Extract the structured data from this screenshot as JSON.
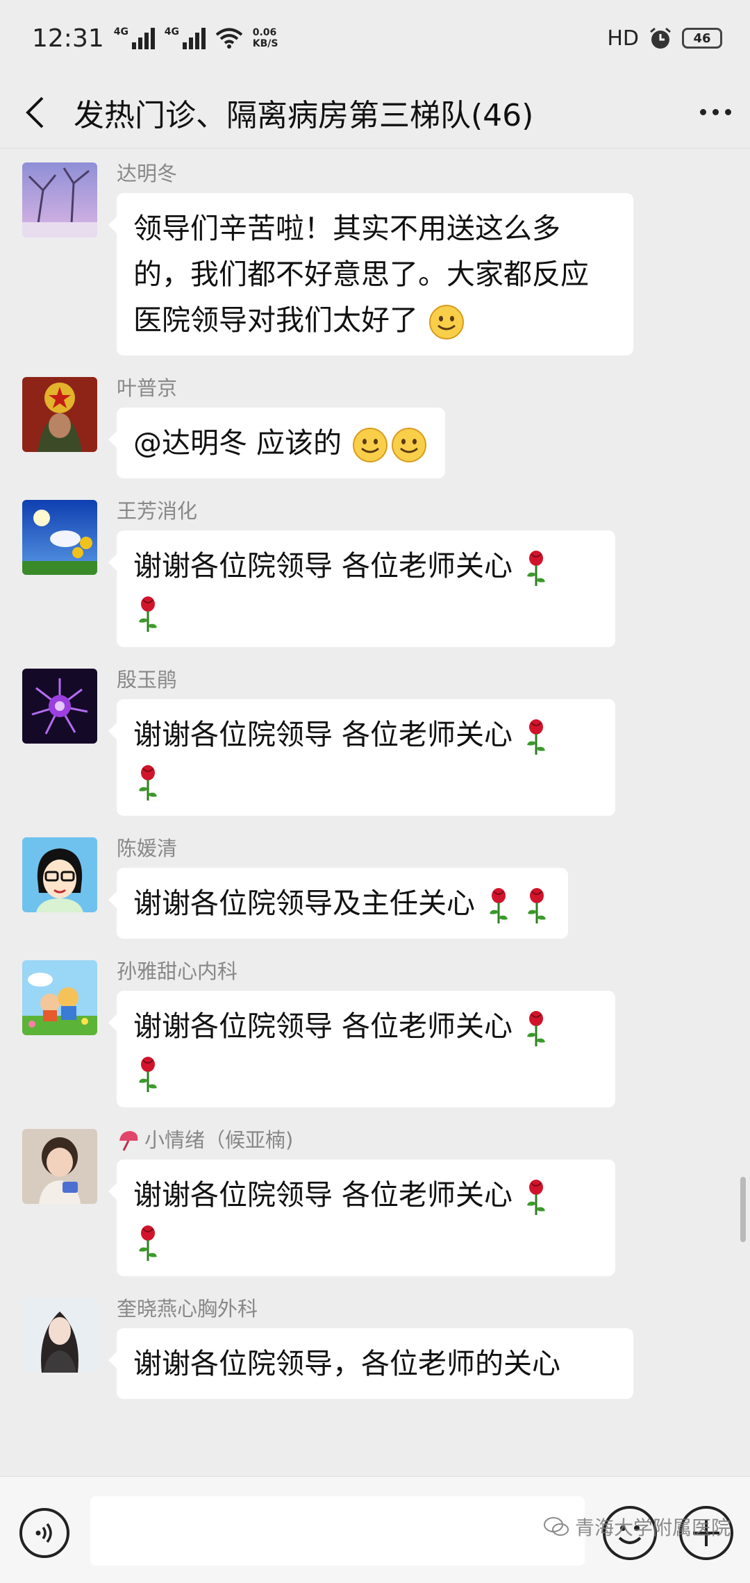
{
  "status_bar": {
    "time": "12:31",
    "signal1_label": "4G",
    "signal2_label": "4G",
    "speed_value": "0.06",
    "speed_unit": "KB/S",
    "hd": "HD",
    "battery": "46"
  },
  "header": {
    "title": "发热门诊、隔离病房第三梯队(46)"
  },
  "messages": [
    {
      "sender": "达明冬",
      "text": "领导们辛苦啦！其实不用送这么多的，我们都不好意思了。大家都反应医院领导对我们太好了",
      "emoji": [
        "smile"
      ]
    },
    {
      "sender": "叶普京",
      "text": "@达明冬  应该的",
      "emoji": [
        "smile",
        "smile"
      ]
    },
    {
      "sender": "王芳消化",
      "text": "谢谢各位院领导 各位老师关心",
      "emoji": [
        "rose",
        "rose"
      ]
    },
    {
      "sender": "殷玉鹃",
      "text": "谢谢各位院领导 各位老师关心",
      "emoji": [
        "rose",
        "rose"
      ]
    },
    {
      "sender": "陈媛清",
      "text": "谢谢各位院领导及主任关心",
      "emoji": [
        "rose",
        "rose"
      ]
    },
    {
      "sender": "孙雅甜心内科",
      "text": "谢谢各位院领导 各位老师关心",
      "emoji": [
        "rose",
        "rose"
      ]
    },
    {
      "sender": "小情绪（候亚楠)",
      "text": "谢谢各位院领导 各位老师关心",
      "emoji": [
        "rose",
        "rose"
      ]
    },
    {
      "sender": "奎晓燕心胸外科",
      "text": "谢谢各位院领导，各位老师的关心",
      "emoji": []
    }
  ],
  "watermark": "青海大学附属医院",
  "icons": {
    "back": "chevron-left-icon",
    "more": "more-dots-icon",
    "voice": "voice-icon",
    "emoji": "emoji-icon",
    "plus": "plus-icon",
    "rose": "rose-icon",
    "smile": "smile-emoji-icon"
  }
}
